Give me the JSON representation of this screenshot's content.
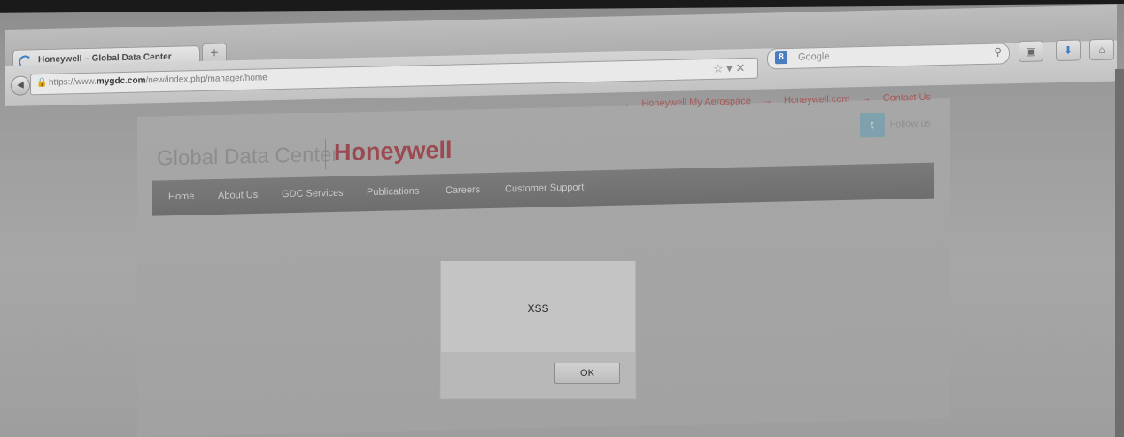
{
  "browser": {
    "tab_title": "Honeywell – Global Data Center",
    "new_tab_label": "+",
    "url_prefix": "https://www.",
    "url_domain": "mygdc.com",
    "url_path": "/new/index.php/manager/home",
    "search_placeholder": "Google",
    "search_engine_badge": "8"
  },
  "site": {
    "top_links": [
      "Honeywell My Aerospace",
      "Honeywell.com",
      "Contact Us"
    ],
    "follow_label": "Follow us",
    "logo_text": "Global Data Center",
    "brand": "Honeywell",
    "menu": [
      "Home",
      "About Us",
      "GDC Services",
      "Publications",
      "Careers",
      "Customer Support"
    ]
  },
  "dialog": {
    "message": "XSS",
    "ok_label": "OK"
  }
}
